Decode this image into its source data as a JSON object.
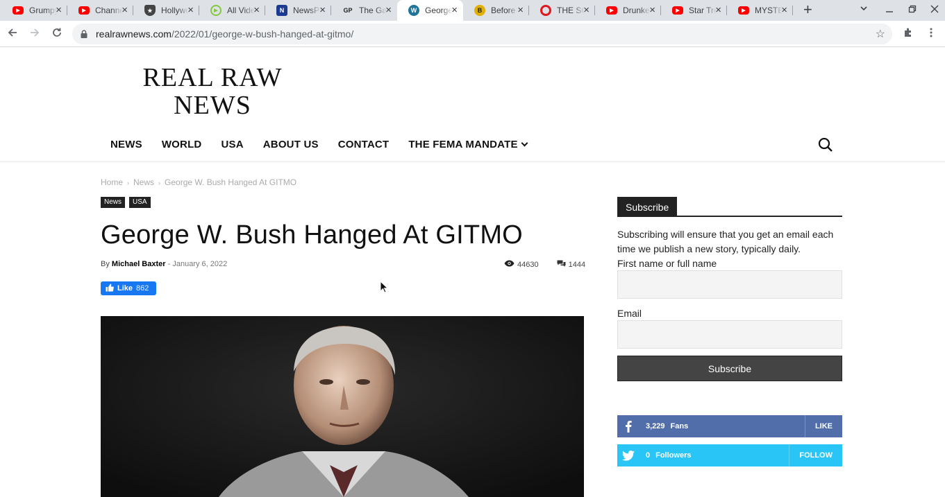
{
  "browser": {
    "tabs": [
      {
        "title": "Grumpy",
        "icon": "youtube-icon",
        "color": "#ff0000"
      },
      {
        "title": "Channel",
        "icon": "youtube-icon",
        "color": "#ff0000"
      },
      {
        "title": "Hollywood",
        "icon": "shield-icon",
        "color": "#444444"
      },
      {
        "title": "All Videos",
        "icon": "rumble-icon",
        "color": "#85c742"
      },
      {
        "title": "NewsPunch",
        "icon": "news-icon",
        "color": "#1a3b8f"
      },
      {
        "title": "The Gateway",
        "icon": "gp-icon",
        "color": "#222222"
      },
      {
        "title": "George",
        "icon": "wordpress-icon",
        "color": "#21759b"
      },
      {
        "title": "Before It's News",
        "icon": "bin-icon",
        "color": "#e0b000"
      },
      {
        "title": "THE SCOOP",
        "icon": "c-icon",
        "color": "#e0191f"
      },
      {
        "title": "Drunken",
        "icon": "youtube-icon",
        "color": "#ff0000"
      },
      {
        "title": "Star Trek",
        "icon": "youtube-icon",
        "color": "#ff0000"
      },
      {
        "title": "MYSTERY",
        "icon": "youtube-icon",
        "color": "#ff0000"
      }
    ],
    "url_host": "realrawnews.com",
    "url_path": "/2022/01/george-w-bush-hanged-at-gitmo/"
  },
  "site": {
    "logo_line1": "REAL RAW",
    "logo_line2": "NEWS",
    "nav": [
      "NEWS",
      "WORLD",
      "USA",
      "ABOUT US",
      "CONTACT",
      "THE FEMA MANDATE"
    ]
  },
  "article": {
    "breadcrumb": [
      "Home",
      "News",
      "George W. Bush Hanged At GITMO"
    ],
    "categories": [
      "News",
      "USA"
    ],
    "title": "George W. Bush Hanged At GITMO",
    "by": "By",
    "author": "Michael Baxter",
    "dash": "-",
    "date": "January 6, 2022",
    "views": "44630",
    "comments": "1444",
    "like_label": "Like",
    "like_count": "862"
  },
  "sidebar": {
    "subscribe_title": "Subscribe",
    "subscribe_text": "Subscribing will ensure that you get an email each time we publish a new story, typically daily.",
    "name_label": "First name or full name",
    "email_label": "Email",
    "subscribe_button": "Subscribe",
    "facebook": {
      "count": "3,229",
      "label": "Fans",
      "action": "LIKE",
      "color": "#516eab"
    },
    "twitter": {
      "count": "0",
      "label": "Followers",
      "action": "FOLLOW",
      "color": "#29c5f6"
    }
  }
}
